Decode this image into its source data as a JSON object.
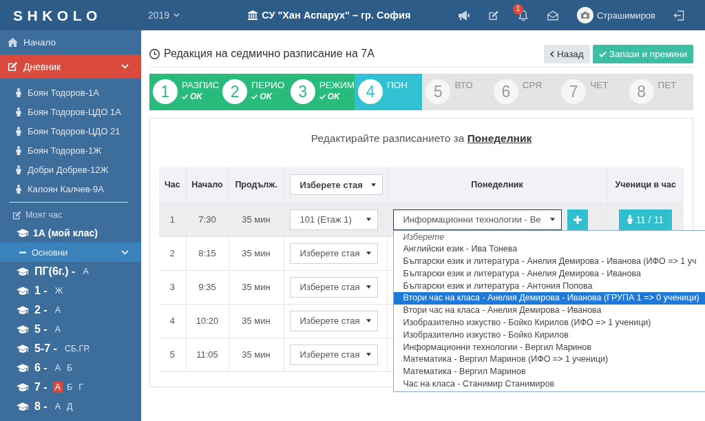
{
  "top_bar": {
    "logo": "SHKOLO",
    "year": "2019",
    "school": "СУ \"Хан Аспарух\" – гр. София",
    "notification_count": "1",
    "user": "Страшимиров"
  },
  "sidebar": {
    "nav": [
      {
        "label": "Начало",
        "selected": false,
        "expanded": false
      },
      {
        "label": "Дневник",
        "selected": true,
        "expanded": true
      }
    ],
    "students": [
      "Боян Тодоров-1А",
      "Боян Тодоров-ЦДО 1А",
      "Боян Тодоров-ЦДО 21",
      "Боян Тодоров-1Ж",
      "Добри Добрев-12Ж",
      "Калоян Калчев-9А"
    ],
    "my_hour": "Моят час",
    "my_class": "1А (мой клас)",
    "group": {
      "label": "Основни",
      "expanded": true
    },
    "grades": [
      {
        "grade": "ПГ(6г.) -",
        "classes": [
          {
            "label": "А",
            "selected": false
          }
        ]
      },
      {
        "grade": "1 -",
        "classes": [
          {
            "label": "Ж",
            "selected": false
          }
        ]
      },
      {
        "grade": "2 -",
        "classes": [
          {
            "label": "А",
            "selected": false
          }
        ]
      },
      {
        "grade": "5 -",
        "classes": [
          {
            "label": "А",
            "selected": false
          }
        ]
      },
      {
        "grade": "5-7 -",
        "classes": [
          {
            "label": "СБ.ГР.",
            "selected": false
          }
        ]
      },
      {
        "grade": "6 -",
        "classes": [
          {
            "label": "А",
            "selected": false
          },
          {
            "label": "Б",
            "selected": false
          }
        ]
      },
      {
        "grade": "7 -",
        "classes": [
          {
            "label": "А",
            "selected": true
          },
          {
            "label": "Б",
            "selected": false
          },
          {
            "label": "Г",
            "selected": false
          }
        ]
      },
      {
        "grade": "8 -",
        "classes": [
          {
            "label": "А",
            "selected": false
          },
          {
            "label": "Д",
            "selected": false
          }
        ]
      }
    ]
  },
  "page": {
    "title": "Редакция на седмично разписание на 7А",
    "buttons": [
      {
        "label": "Назад",
        "kind": "back"
      },
      {
        "label": "Запази и премини",
        "kind": "save"
      }
    ]
  },
  "steps": [
    {
      "number": "1",
      "label": "РАЗПИС",
      "completed": true,
      "selected": false,
      "note": "OK"
    },
    {
      "number": "2",
      "label": "ПЕРИО",
      "completed": true,
      "selected": false,
      "note": "OK"
    },
    {
      "number": "3",
      "label": "РЕЖИМ",
      "completed": true,
      "selected": false,
      "note": "OK"
    },
    {
      "number": "4",
      "label": "ПОН",
      "completed": false,
      "selected": true
    },
    {
      "number": "5",
      "label": "ВТО",
      "completed": false,
      "selected": false
    },
    {
      "number": "6",
      "label": "СРЯ",
      "completed": false,
      "selected": false
    },
    {
      "number": "7",
      "label": "ЧЕТ",
      "completed": false,
      "selected": false
    },
    {
      "number": "8",
      "label": "ПЕТ",
      "completed": false,
      "selected": false
    }
  ],
  "schedule": {
    "heading": "Редактирайте разписанието за **Понеделник**",
    "table": {
      "columns": [
        {
          "kind": "text",
          "label": "Час"
        },
        {
          "kind": "text",
          "label": "Начало"
        },
        {
          "kind": "text",
          "label": "Продълж."
        },
        {
          "kind": "select",
          "value": "Изберете стая"
        },
        {
          "kind": "text",
          "label": "Понеделник"
        },
        {
          "kind": "text",
          "label": "Ученици в час"
        }
      ],
      "rows": [
        {
          "hour": "1",
          "start": "7:30",
          "duration": "35 мин",
          "room": "101 (Етаж 1)",
          "highlighted": true,
          "subject": {
            "value": "Информационни технологии - Ве",
            "open": true,
            "options": [
              {
                "label": "Изберете",
                "kind": "placeholder",
                "selected": false
              },
              {
                "label": "Английски език - Ива Тонева",
                "kind": "option",
                "selected": false
              },
              {
                "label": "Български език и литература - Анелия Демирова - Иванова (ИФО => 1 уч",
                "kind": "option",
                "selected": false
              },
              {
                "label": "Български език и литература - Анелия Демирова - Иванова",
                "kind": "option",
                "selected": false
              },
              {
                "label": "Български език и литература - Антония Попова",
                "kind": "option",
                "selected": false
              },
              {
                "label": "Втори час на класа - Анелия Демирова - Иванова (ГРУПА 1 => 0 ученици)",
                "kind": "option",
                "selected": true
              },
              {
                "label": "Втори час на класа - Анелия Демирова - Иванова",
                "kind": "option",
                "selected": false
              },
              {
                "label": "Изобразително изкуство - Бойко Кирилов (ИФО => 1 ученици)",
                "kind": "option",
                "selected": false
              },
              {
                "label": "Изобразително изкуство - Бойко Кирилов",
                "kind": "option",
                "selected": false
              },
              {
                "label": "Информационни технологии - Вергил Маринов",
                "kind": "option",
                "selected": false
              },
              {
                "label": "Математика - Вергил Маринов (ИФО => 1 ученици)",
                "kind": "option",
                "selected": false
              },
              {
                "label": "Математика - Вергил Маринов",
                "kind": "option",
                "selected": false
              },
              {
                "label": "Час на класа - Станимир Станимиров",
                "kind": "option",
                "selected": false
              }
            ]
          },
          "students": "11 / 11"
        },
        {
          "hour": "2",
          "start": "8:15",
          "duration": "35 мин",
          "room": "Изберете стая",
          "highlighted": false
        },
        {
          "hour": "3",
          "start": "9:35",
          "duration": "35 мин",
          "room": "Изберете стая",
          "highlighted": false
        },
        {
          "hour": "4",
          "start": "10:20",
          "duration": "35 мин",
          "room": "Изберете стая",
          "highlighted": false
        },
        {
          "hour": "5",
          "start": "11:05",
          "duration": "35 мин",
          "room": "Изберете стая",
          "highlighted": false
        }
      ]
    }
  }
}
